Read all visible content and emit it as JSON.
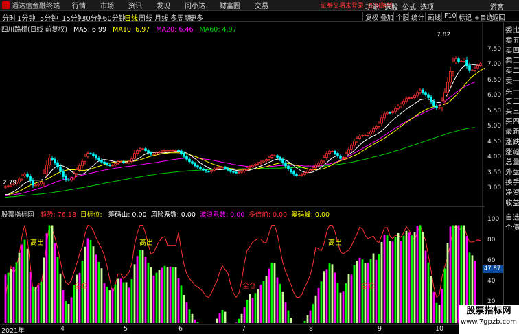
{
  "app": {
    "title": "通达信金融终端",
    "menu": [
      "行情",
      "市场",
      "资讯",
      "发现",
      "问小达",
      "财富圈",
      "交易"
    ],
    "login_warning": "证券交易未登录",
    "security_name": "四川路桥",
    "right_menu": [
      "功能",
      "选股",
      "公式",
      "选项"
    ],
    "guest": "游客"
  },
  "periods": [
    "分时",
    "1分钟",
    "5分钟",
    "15分钟",
    "30分钟",
    "60分钟",
    "日线",
    "周线",
    "月线",
    "多周期",
    "更多"
  ],
  "active_period": "日线",
  "toolbar": [
    "复权",
    "叠加",
    "个股",
    "统计",
    "画线",
    "F10",
    "标记",
    "+自选",
    "返回"
  ],
  "legend_main": {
    "title": "四川路桥(日线 前复权)",
    "ma5": "MA5: 6.99",
    "ma10": "MA10: 6.97",
    "ma20": "MA20: 6.46",
    "ma60": "MA60: 4.97"
  },
  "legend_ind": {
    "name": "股票指标网",
    "items": [
      {
        "text": "趋势: 76.18",
        "color": "#ff3333"
      },
      {
        "text": "目标位: ",
        "color": "#ffff00"
      },
      {
        "text": "筹码山: 0.00",
        "color": "#ffffff"
      },
      {
        "text": "风险系数: 0.00",
        "color": "#ffffff"
      },
      {
        "text": "波浪系数: 0.00",
        "color": "#ff00ff"
      },
      {
        "text": "多倍前: 0.00",
        "color": "#ff3333"
      },
      {
        "text": "筹码峰: 0.00",
        "color": "#ffff00"
      }
    ]
  },
  "price_axis": [
    "7.50",
    "7.00",
    "6.50",
    "6.00",
    "5.50",
    "5.00",
    "4.50",
    "4.00",
    "3.50",
    "3.00"
  ],
  "price_high_label": "7.82",
  "price_low_label": "2.79",
  "ind_axis": [
    "100",
    "80",
    "60",
    "40",
    "20"
  ],
  "ind_current_value": "47.87",
  "labels": {
    "gaochu": "高出",
    "quancang": "全仓"
  },
  "sidebar": [
    "委比",
    "卖五",
    "卖四",
    "卖三",
    "卖二",
    "卖一",
    "买一",
    "买二",
    "买三",
    "买四",
    "最新",
    "涨跌",
    "涨幅",
    "总量",
    "外盘",
    "换手",
    "净资",
    "收益"
  ],
  "sidebar_bottom": [
    "自选",
    "个债"
  ],
  "dates": [
    "2021年",
    "4",
    "5",
    "6",
    "7",
    "8",
    "9",
    "10"
  ],
  "watermark": {
    "title": "股票指标网",
    "url": "www.7gpzb.com"
  },
  "colors": {
    "up": "#ff3333",
    "down": "#00ffff",
    "ma5": "#ffffff",
    "ma10": "#ffff00",
    "ma20": "#ff00ff",
    "ma60": "#00cc00",
    "accent": "#ffff00"
  },
  "chart_data": {
    "type": "candlestick",
    "close": [
      3.08,
      3.1,
      3.14,
      3.16,
      3.22,
      3.32,
      3.42,
      3.48,
      3.4,
      3.26,
      3.12,
      3.12,
      3.16,
      3.22,
      3.5,
      3.78,
      4.0,
      3.95,
      3.85,
      3.72,
      3.56,
      3.4,
      3.3,
      3.28,
      3.36,
      3.5,
      3.62,
      3.75,
      3.89,
      4.05,
      4.15,
      4.14,
      4.08,
      4.0,
      3.93,
      3.87,
      3.82,
      3.78,
      3.75,
      3.77,
      3.82,
      3.88,
      3.88,
      3.85,
      3.85,
      3.89,
      3.98,
      4.15,
      4.24,
      4.3,
      4.3,
      4.24,
      4.17,
      4.12,
      4.13,
      4.17,
      4.2,
      4.23,
      4.25,
      4.25,
      4.25,
      4.25,
      4.25,
      4.23,
      4.15,
      4.05,
      3.96,
      3.88,
      3.82,
      3.75,
      3.7,
      3.65,
      3.61,
      3.57,
      3.56,
      3.6,
      3.65,
      3.67,
      3.7,
      3.7,
      3.66,
      3.61,
      3.56,
      3.54,
      3.53,
      3.54,
      3.57,
      3.62,
      3.68,
      3.72,
      3.76,
      3.8,
      3.83,
      3.87,
      3.9,
      3.95,
      4.02,
      4.08,
      4.08,
      4.02,
      3.95,
      3.85,
      3.74,
      3.64,
      3.55,
      3.48,
      3.44,
      3.44,
      3.47,
      3.53,
      3.58,
      3.62,
      3.68,
      3.76,
      3.83,
      3.9,
      4.02,
      4.15,
      4.22,
      4.22,
      4.15,
      4.06,
      3.98,
      4.02,
      4.14,
      4.28,
      4.41,
      4.55,
      4.64,
      4.71,
      4.73,
      4.73,
      4.77,
      4.85,
      4.95,
      5.02,
      5.12,
      5.3,
      5.43,
      5.47,
      5.46,
      5.5,
      5.6,
      5.68,
      5.74,
      5.84,
      5.93,
      5.95,
      5.95,
      6.02,
      6.12,
      6.2,
      6.12,
      6.05,
      5.95,
      5.83,
      5.69,
      5.61,
      5.63,
      5.85,
      6.12,
      6.45,
      6.79,
      7.1,
      7.21,
      7.12,
      7.13,
      7.17,
      6.99,
      6.84,
      6.84,
      6.91,
      6.99,
      7.05
    ],
    "ma5": [
      2.82,
      2.82,
      2.88,
      2.91,
      2.97,
      3.04,
      3.11,
      3.18,
      3.23,
      3.27,
      3.28,
      3.28,
      3.28,
      3.29,
      3.33,
      3.41,
      3.51,
      3.61,
      3.69,
      3.74,
      3.76,
      3.74,
      3.7,
      3.65,
      3.57,
      3.51,
      3.48,
      3.47,
      3.48,
      3.52,
      3.6,
      3.68,
      3.76,
      3.84,
      3.91,
      3.94,
      3.95,
      3.94,
      3.92,
      3.9,
      3.88,
      3.86,
      3.86,
      3.87,
      3.87,
      3.88,
      3.89,
      3.92,
      3.96,
      4.01,
      4.08,
      4.13,
      4.16,
      4.18,
      4.18,
      4.18,
      4.17,
      4.17,
      4.17,
      4.18,
      4.19,
      4.2,
      4.21,
      4.22,
      4.21,
      4.19,
      4.16,
      4.11,
      4.05,
      3.98,
      3.91,
      3.84,
      3.78,
      3.73,
      3.68,
      3.65,
      3.63,
      3.62,
      3.62,
      3.63,
      3.64,
      3.64,
      3.63,
      3.62,
      3.6,
      3.59,
      3.58,
      3.58,
      3.59,
      3.61,
      3.64,
      3.67,
      3.71,
      3.74,
      3.78,
      3.82,
      3.86,
      3.9,
      3.94,
      3.96,
      3.97,
      3.96,
      3.93,
      3.88,
      3.82,
      3.75,
      3.68,
      3.62,
      3.57,
      3.54,
      3.53,
      3.53,
      3.55,
      3.59,
      3.64,
      3.7,
      3.77,
      3.85,
      3.93,
      4.0,
      4.05,
      4.07,
      4.07,
      4.06,
      4.07,
      4.11,
      4.17,
      4.25,
      4.33,
      4.42,
      4.5,
      4.57,
      4.62,
      4.67,
      4.71,
      4.76,
      4.81,
      4.88,
      4.96,
      5.05,
      5.14,
      5.22,
      5.3,
      5.37,
      5.44,
      5.51,
      5.58,
      5.64,
      5.7,
      5.76,
      5.82,
      5.88,
      5.9,
      5.91,
      5.9,
      5.88,
      5.84,
      5.8,
      5.79,
      5.83,
      5.93,
      6.07,
      6.25,
      6.44,
      6.62,
      6.77,
      6.89,
      6.98,
      7.03,
      7.03,
      7.02,
      7.01,
      7.0,
      6.99
    ],
    "ma10": [
      2.8,
      2.82,
      2.84,
      2.86,
      2.89,
      2.93,
      2.97,
      3.02,
      3.07,
      3.12,
      3.16,
      3.19,
      3.22,
      3.24,
      3.27,
      3.31,
      3.36,
      3.41,
      3.46,
      3.51,
      3.55,
      3.58,
      3.6,
      3.62,
      3.62,
      3.62,
      3.61,
      3.6,
      3.6,
      3.6,
      3.62,
      3.64,
      3.67,
      3.7,
      3.73,
      3.76,
      3.79,
      3.82,
      3.84,
      3.86,
      3.87,
      3.88,
      3.89,
      3.89,
      3.89,
      3.89,
      3.89,
      3.9,
      3.92,
      3.94,
      3.97,
      4.0,
      4.03,
      4.06,
      4.08,
      4.1,
      4.12,
      4.14,
      4.15,
      4.16,
      4.17,
      4.17,
      4.17,
      4.17,
      4.16,
      4.15,
      4.13,
      4.11,
      4.08,
      4.05,
      4.02,
      3.98,
      3.94,
      3.9,
      3.86,
      3.82,
      3.79,
      3.76,
      3.73,
      3.71,
      3.69,
      3.67,
      3.66,
      3.65,
      3.64,
      3.63,
      3.63,
      3.63,
      3.63,
      3.63,
      3.64,
      3.65,
      3.66,
      3.68,
      3.7,
      3.72,
      3.75,
      3.77,
      3.8,
      3.82,
      3.84,
      3.84,
      3.84,
      3.82,
      3.81,
      3.78,
      3.76,
      3.73,
      3.7,
      3.67,
      3.65,
      3.63,
      3.62,
      3.62,
      3.63,
      3.64,
      3.66,
      3.7,
      3.74,
      3.79,
      3.83,
      3.87,
      3.91,
      3.94,
      3.97,
      4.0,
      4.04,
      4.08,
      4.12,
      4.17,
      4.23,
      4.28,
      4.34,
      4.39,
      4.44,
      4.49,
      4.54,
      4.59,
      4.64,
      4.7,
      4.76,
      4.82,
      4.88,
      4.95,
      5.02,
      5.09,
      5.15,
      5.21,
      5.28,
      5.34,
      5.4,
      5.46,
      5.51,
      5.56,
      5.6,
      5.63,
      5.66,
      5.68,
      5.69,
      5.71,
      5.74,
      5.78,
      5.85,
      5.93,
      6.02,
      6.12,
      6.23,
      6.34,
      6.45,
      6.55,
      6.63,
      6.7,
      6.77,
      6.83,
      6.88,
      6.93
    ],
    "ma20": [
      2.78,
      2.79,
      2.8,
      2.81,
      2.83,
      2.84,
      2.86,
      2.88,
      2.91,
      2.93,
      2.96,
      2.98,
      3.01,
      3.04,
      3.07,
      3.1,
      3.14,
      3.17,
      3.21,
      3.24,
      3.27,
      3.3,
      3.33,
      3.35,
      3.37,
      3.39,
      3.41,
      3.43,
      3.45,
      3.47,
      3.49,
      3.51,
      3.53,
      3.55,
      3.57,
      3.59,
      3.61,
      3.62,
      3.64,
      3.65,
      3.67,
      3.68,
      3.69,
      3.71,
      3.72,
      3.73,
      3.74,
      3.76,
      3.77,
      3.78,
      3.79,
      3.81,
      3.82,
      3.83,
      3.84,
      3.86,
      3.87,
      3.89,
      3.9,
      3.92,
      3.93,
      3.95,
      3.96,
      3.97,
      3.98,
      3.99,
      3.99,
      4.0,
      4.0,
      4.0,
      3.99,
      3.98,
      3.97,
      3.96,
      3.95,
      3.93,
      3.92,
      3.9,
      3.88,
      3.86,
      3.85,
      3.83,
      3.81,
      3.79,
      3.78,
      3.76,
      3.75,
      3.74,
      3.73,
      3.72,
      3.71,
      3.71,
      3.71,
      3.71,
      3.71,
      3.72,
      3.72,
      3.73,
      3.74,
      3.75,
      3.76,
      3.76,
      3.77,
      3.77,
      3.77,
      3.77,
      3.76,
      3.76,
      3.75,
      3.74,
      3.74,
      3.74,
      3.74,
      3.74,
      3.74,
      3.75,
      3.77,
      3.79,
      3.81,
      3.83,
      3.86,
      3.89,
      3.93,
      3.97,
      4.01,
      4.06,
      4.11,
      4.16,
      4.21,
      4.26,
      4.31,
      4.36,
      4.41,
      4.46,
      4.51,
      4.56,
      4.61,
      4.67,
      4.73,
      4.79,
      4.85,
      4.91,
      4.97,
      5.02,
      5.08,
      5.13,
      5.18,
      5.23,
      5.27,
      5.32,
      5.36,
      5.4,
      5.45,
      5.49,
      5.53,
      5.57,
      5.61,
      5.66,
      5.71,
      5.77,
      5.83,
      5.9,
      5.97,
      6.04,
      6.11,
      6.18,
      6.24,
      6.29,
      6.34,
      6.38,
      6.42,
      6.46
    ],
    "ma60": [
      2.73,
      2.74,
      2.75,
      2.75,
      2.76,
      2.77,
      2.78,
      2.79,
      2.8,
      2.8,
      2.81,
      2.82,
      2.83,
      2.84,
      2.85,
      2.86,
      2.87,
      2.88,
      2.9,
      2.91,
      2.92,
      2.94,
      2.95,
      2.97,
      2.98,
      3.0,
      3.01,
      3.03,
      3.04,
      3.06,
      3.08,
      3.09,
      3.11,
      3.13,
      3.14,
      3.16,
      3.18,
      3.2,
      3.21,
      3.23,
      3.25,
      3.26,
      3.28,
      3.3,
      3.31,
      3.33,
      3.35,
      3.36,
      3.38,
      3.39,
      3.41,
      3.42,
      3.44,
      3.45,
      3.46,
      3.48,
      3.49,
      3.5,
      3.51,
      3.52,
      3.53,
      3.54,
      3.55,
      3.56,
      3.57,
      3.57,
      3.58,
      3.59,
      3.59,
      3.6,
      3.6,
      3.61,
      3.61,
      3.62,
      3.62,
      3.62,
      3.63,
      3.63,
      3.63,
      3.63,
      3.64,
      3.64,
      3.64,
      3.64,
      3.64,
      3.65,
      3.65,
      3.65,
      3.65,
      3.65,
      3.65,
      3.66,
      3.66,
      3.66,
      3.66,
      3.66,
      3.67,
      3.67,
      3.67,
      3.67,
      3.67,
      3.68,
      3.68,
      3.68,
      3.68,
      3.69,
      3.69,
      3.69,
      3.69,
      3.7,
      3.7,
      3.71,
      3.71,
      3.72,
      3.72,
      3.73,
      3.74,
      3.75,
      3.76,
      3.77,
      3.78,
      3.79,
      3.8,
      3.82,
      3.83,
      3.85,
      3.86,
      3.88,
      3.9,
      3.92,
      3.94,
      3.96,
      3.98,
      4.0,
      4.03,
      4.05,
      4.07,
      4.1,
      4.12,
      4.15,
      4.17,
      4.2,
      4.23,
      4.25,
      4.28,
      4.31,
      4.34,
      4.37,
      4.4,
      4.43,
      4.46,
      4.49,
      4.52,
      4.55,
      4.58,
      4.61,
      4.64,
      4.67,
      4.7,
      4.73,
      4.76,
      4.79,
      4.82,
      4.84,
      4.86,
      4.89,
      4.91,
      4.93,
      4.95,
      4.97,
      4.98,
      4.99
    ]
  }
}
